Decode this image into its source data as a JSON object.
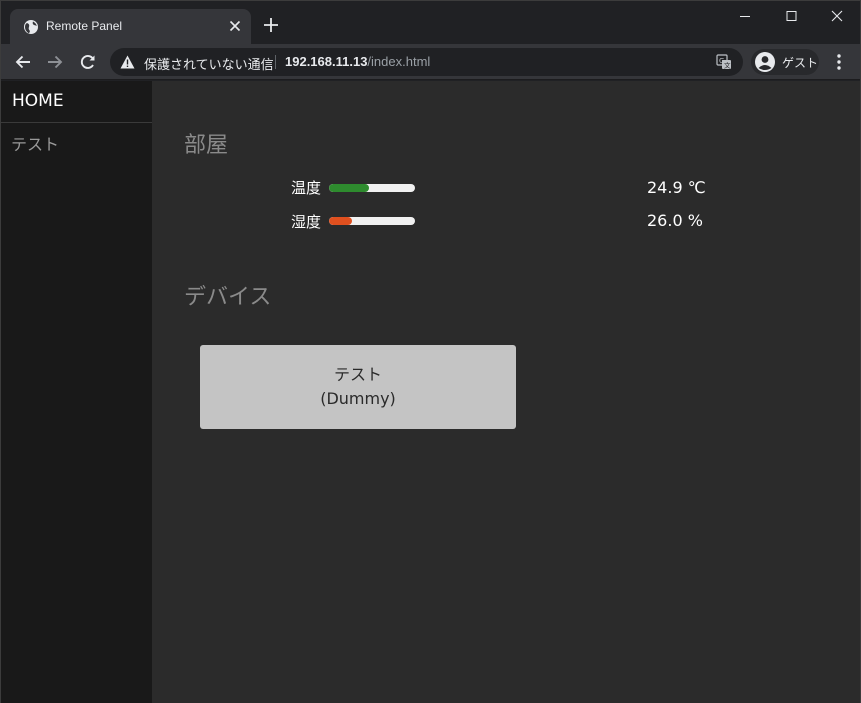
{
  "browser": {
    "tab_title": "Remote Panel",
    "security_label": "保護されていない通信",
    "url_host": "192.168.11.13",
    "url_path": "/index.html",
    "profile_label": "ゲスト"
  },
  "sidebar": {
    "home": "HOME",
    "items": [
      {
        "label": "テスト"
      }
    ]
  },
  "room": {
    "title": "部屋",
    "sensors": [
      {
        "label": "温度",
        "value": "24.9 ℃",
        "level": 0.46,
        "color": "#2e8b2e"
      },
      {
        "label": "湿度",
        "value": "26.0 %",
        "level": 0.27,
        "color": "#e0501f"
      }
    ]
  },
  "devices": {
    "title": "デバイス",
    "items": [
      {
        "name": "テスト",
        "subtitle": "(Dummy)"
      }
    ]
  }
}
